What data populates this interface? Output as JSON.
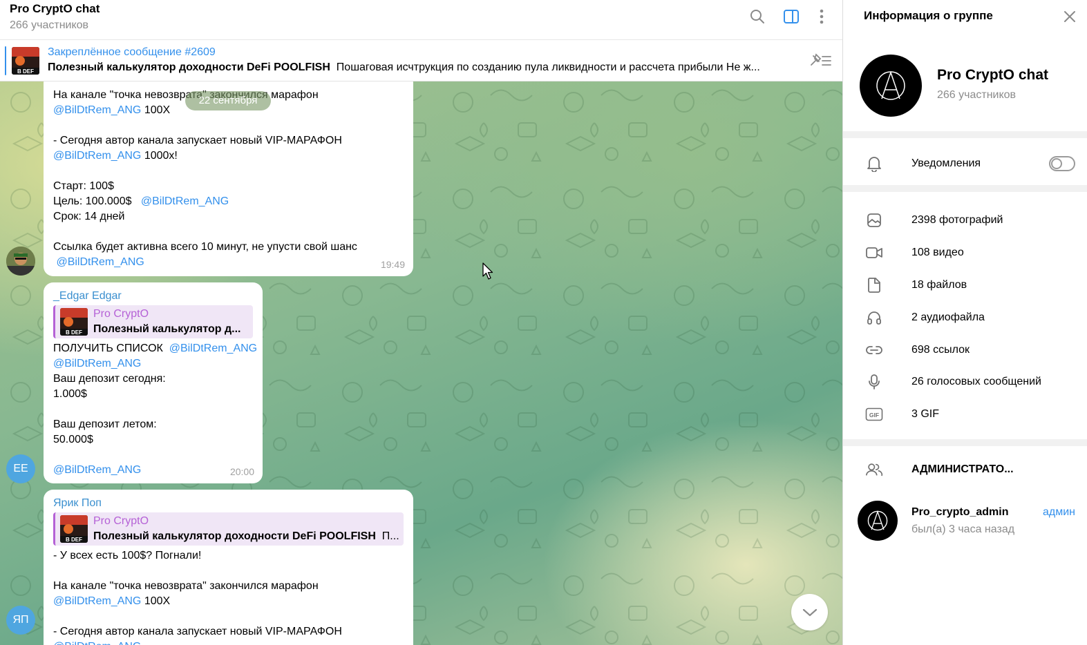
{
  "chat": {
    "title": "Pro CryptO chat",
    "subtitle": "266 участников",
    "pinned": {
      "title": "Закреплённое сообщение #2609",
      "bold": "Полезный калькулятор доходности DeFi POOLFISH",
      "rest": "Пошаговая исчтрукция по созданию пула ликвидности и рассчета прибыли  Не ж..."
    },
    "date_chip": "22 сентября",
    "messages": [
      {
        "lines": [
          "На канале \"точка невозврата\" закончился марафон",
          "@BilDtRem_ANG|100X",
          "",
          "- Сегодня автор канала запускает новый VIP-МАРАФОН",
          "@BilDtRem_ANG|1000x!",
          "",
          "Старт: 100$",
          "Цель: 100.000$",
          "Срок: 14 дней",
          "",
          "Ссылка будет активна всего 10 минут, не упусти свой шанс",
          "@BilDtRem_ANG"
        ],
        "mention": "@BilDtRem_ANG",
        "suffix_1": " 100X",
        "suffix_2": " 1000x!",
        "goal_mention": "@BilDtRem_ANG",
        "time": "19:49"
      },
      {
        "sender": "_Edgar Edgar",
        "reply_title": "Pro CryptO",
        "reply_text": "Полезный калькулятор д...",
        "lines_a": "ПОЛУЧИТЬ СПИСОК",
        "mention": "@BilDtRem_ANG",
        "deposit_today_label": "Ваш депозит сегодня:",
        "deposit_today": "1.000$",
        "deposit_summer_label": "Ваш депозит летом:",
        "deposit_summer": "50.000$",
        "time": "20:00",
        "avatar": "EE",
        "avatar_color": "#4fa6e0"
      },
      {
        "sender": "Ярик Поп",
        "reply_title": "Pro CryptO",
        "reply_text": "Полезный калькулятор доходности DeFi POOLFISH",
        "reply_extra": "П...",
        "line1": "- У всех есть 100$? Погнали!",
        "line2": "На канале \"точка невозврата\" закончился марафон",
        "mention": "@BilDtRem_ANG",
        "suffix": " 100X",
        "line3": "- Сегодня автор канала запускает новый VIP-МАРАФОН",
        "avatar": "ЯП",
        "avatar_color": "#4fa6e0"
      }
    ]
  },
  "panel": {
    "title": "Информация о группе",
    "group_name": "Pro CryptO chat",
    "group_members": "266 участников",
    "notifications": "Уведомления",
    "media": [
      {
        "icon": "photo-icon",
        "label": "2398 фотографий"
      },
      {
        "icon": "video-icon",
        "label": "108 видео"
      },
      {
        "icon": "file-icon",
        "label": "18 файлов"
      },
      {
        "icon": "headphones-icon",
        "label": "2 аудиофайла"
      },
      {
        "icon": "link-icon",
        "label": "698 ссылок"
      },
      {
        "icon": "microphone-icon",
        "label": "26 голосовых сообщений"
      },
      {
        "icon": "gif-icon",
        "label": "3 GIF"
      }
    ],
    "admins_label": "АДМИНИСТРАТО...",
    "admin": {
      "name": "Pro_crypto_admin",
      "last_seen": "был(а) 3 часа назад",
      "role": "админ"
    },
    "notifications_enabled": false
  },
  "colors": {
    "accent": "#3390ec",
    "reply_accent": "#b561d6",
    "sender_color": "#3a8fcf"
  }
}
